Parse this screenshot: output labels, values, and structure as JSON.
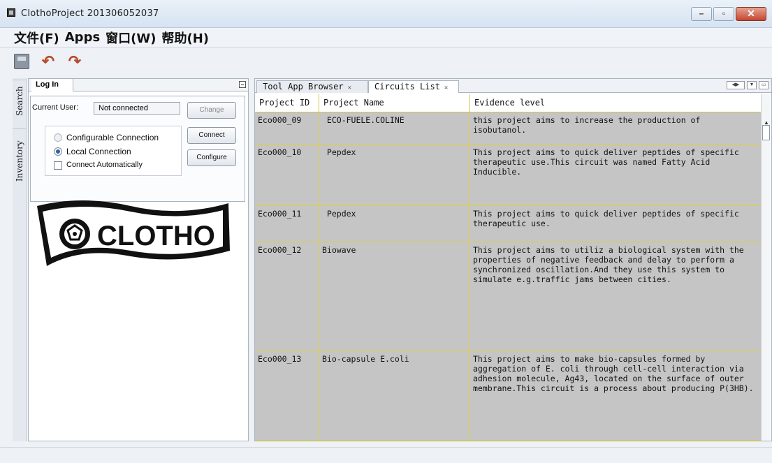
{
  "window": {
    "title": "ClothoProject 201306052037"
  },
  "menu": {
    "items": [
      "文件(F)",
      "Apps",
      "窗口(W)",
      "帮助(H)"
    ]
  },
  "toolbar": {
    "icons": [
      "save-icon",
      "undo-icon",
      "redo-icon"
    ]
  },
  "side_tabs": {
    "search": "Search",
    "inventory": "Inventory"
  },
  "login": {
    "tab": "Log In",
    "current_user_label": "Current User:",
    "current_user_value": "Not connected",
    "change": "Change",
    "configurable_connection": "Configurable Connection",
    "local_connection": "Local Connection",
    "connect_automatically": "Connect Automatically",
    "connect": "Connect",
    "configure": "Configure",
    "logo_text": "CLOTHO"
  },
  "tabs": [
    {
      "label": "Tool App Browser",
      "active": false
    },
    {
      "label": "Circuits List",
      "active": true
    }
  ],
  "table": {
    "columns": [
      "Project ID",
      "Project Name",
      "Evidence level"
    ],
    "rows": [
      {
        "id": "Eco000_09",
        "name": " ECO-FUELE.COLINE",
        "evidence": "this project aims to increase the production of isobutanol."
      },
      {
        "id": "Eco000_10",
        "name": " Pepdex",
        "evidence": "This project aims to quick deliver peptides of specific therapeutic use.This circuit was named Fatty Acid Inducible."
      },
      {
        "id": "Eco000_11",
        "name": " Pepdex",
        "evidence": "This project aims to quick deliver peptides of specific therapeutic use."
      },
      {
        "id": "Eco000_12",
        "name": "Biowave",
        "evidence": "This project aims to utiliz a biological system with the properties of negative feedback and delay to perform a synchronized oscillation.And they use this system to simulate e.g.traffic jams between cities."
      },
      {
        "id": "Eco000_13",
        "name": "Bio-capsule E.coli",
        "evidence": "This project aims to make bio-capsules formed by aggregation of E. coli through cell-cell interaction via adhesion molecule, Ag43, located on the surface of outer membrane.This circuit is a process about producing P(3HB)."
      }
    ]
  }
}
